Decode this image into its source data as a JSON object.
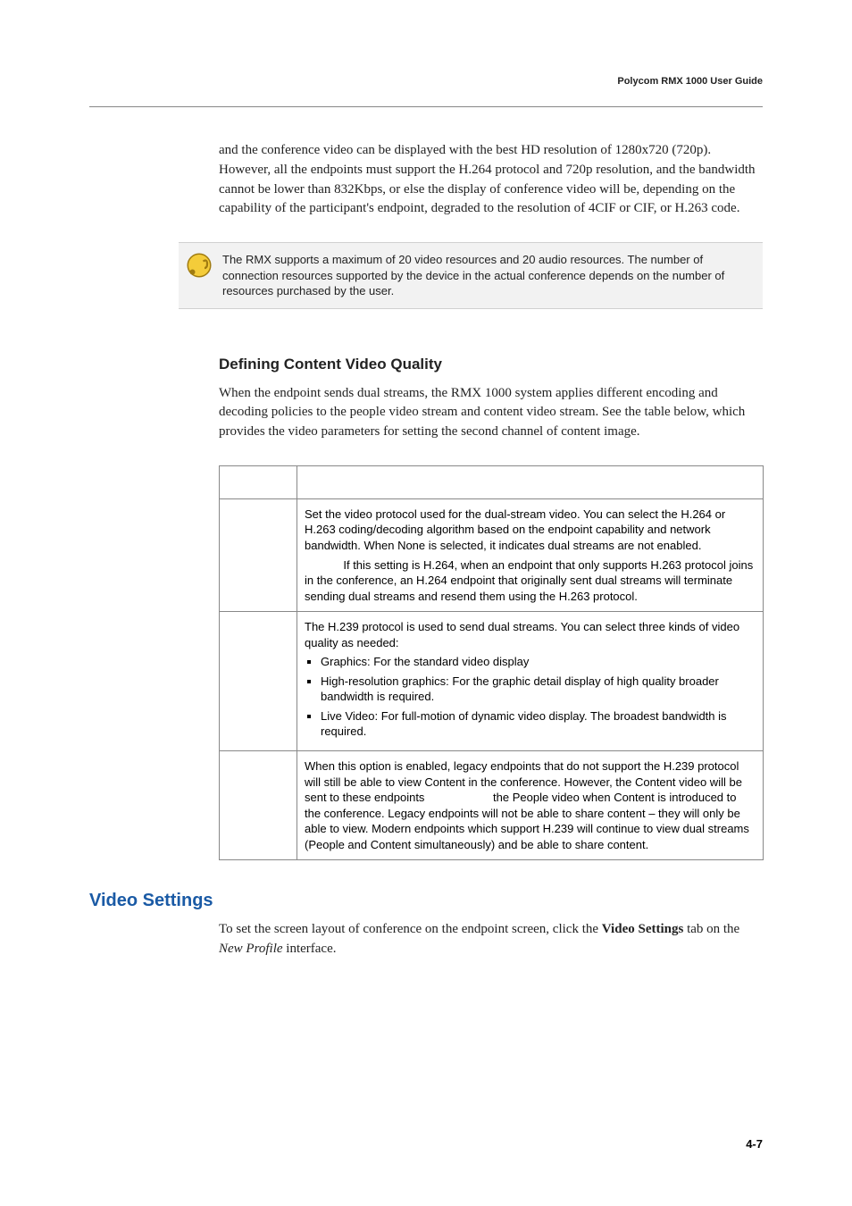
{
  "header": {
    "title": "Polycom RMX 1000 User Guide"
  },
  "paragraphs": {
    "intro": "and the conference video can be displayed with the best HD resolution of 1280x720 (720p). However, all the endpoints must support the H.264 protocol and 720p resolution, and the bandwidth cannot be lower than 832Kbps, or else the display of conference video will be, depending on the capability of the participant's endpoint, degraded to the resolution of 4CIF or CIF, or H.263 code."
  },
  "note": {
    "text": "The RMX supports a maximum of 20 video resources and 20 audio resources. The number of connection resources supported by the device in the actual conference depends on the number of resources purchased by the user."
  },
  "section1": {
    "heading": "Defining Content Video Quality",
    "para": "When the endpoint sends dual streams, the RMX 1000 system applies different encoding and decoding policies to the people video stream and content video stream. See the table below, which provides the video parameters for setting the second channel of content image."
  },
  "table": {
    "rows": [
      {
        "p1": "Set the video protocol used for the dual-stream video. You can select the H.264 or H.263 coding/decoding algorithm based on the endpoint capability and network bandwidth. When None is selected, it indicates dual streams are not enabled.",
        "p2_prefix": "",
        "p2": "If this setting is H.264, when an endpoint that only supports H.263 protocol joins in the conference, an H.264 endpoint that originally sent dual streams will terminate sending dual streams and resend them using the H.263 protocol."
      },
      {
        "intro": "The H.239 protocol is used to send dual streams. You can select three kinds of video quality as needed:",
        "bullets": [
          "Graphics: For the standard video display",
          "High-resolution graphics: For the graphic detail display of high quality broader bandwidth is required.",
          "Live Video: For full-motion of dynamic video display. The broadest bandwidth is required."
        ]
      },
      {
        "p1a": "When this option is enabled, legacy endpoints that do not support the H.239 protocol will still be able to view Content in the conference. However, the Content video will be sent to these endpoints ",
        "p1b": " the People video when Content is introduced to the conference. Legacy endpoints will not be able to share content – they will only be able to view. Modern endpoints which support H.239 will continue to view dual streams (People and Content simultaneously) and be able to share content."
      }
    ]
  },
  "section2": {
    "heading": "Video Settings",
    "para_before": "To set the screen layout of conference on the endpoint screen, click the ",
    "bold": "Video Settings",
    "mid": " tab on the ",
    "italic": "New Profile",
    "after": " interface."
  },
  "footer": {
    "pagenum": "4-7"
  }
}
